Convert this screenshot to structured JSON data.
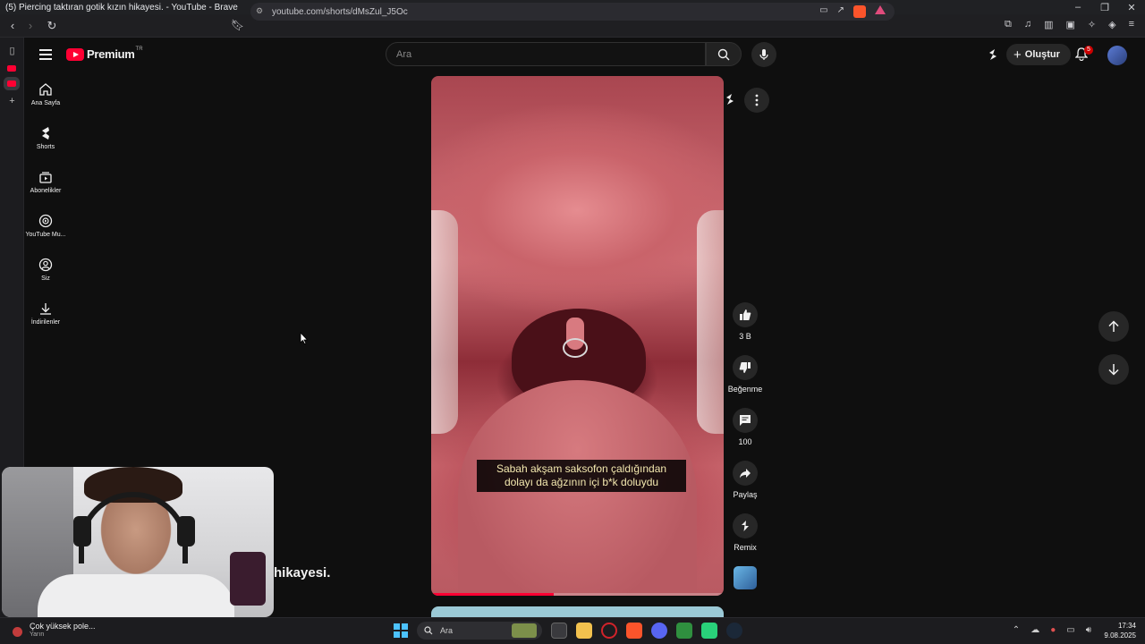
{
  "browser": {
    "window_title": "(5) Piercing taktıran gotik kızın hikayesi. - YouTube - Brave",
    "url": "youtube.com/shorts/dMsZul_J5Oc"
  },
  "youtube": {
    "logo_text": "Premium",
    "logo_region": "TR",
    "search_placeholder": "Ara",
    "create_label": "Oluştur",
    "notification_count": "5"
  },
  "sidebar": {
    "items": [
      {
        "label": "Ana Sayfa",
        "icon": "home-icon"
      },
      {
        "label": "Shorts",
        "icon": "shorts-icon"
      },
      {
        "label": "Abonelikler",
        "icon": "subscriptions-icon"
      },
      {
        "label": "YouTube Mu...",
        "icon": "youtube-music-icon"
      },
      {
        "label": "Siz",
        "icon": "user-icon"
      },
      {
        "label": "İndirilenler",
        "icon": "download-icon"
      }
    ]
  },
  "short": {
    "subtitle_line1": "Sabah akşam saksofon çaldığından",
    "subtitle_line2": "dolayı da ağzının içi b*k doluydu",
    "title_partial": "hikayesi.",
    "progress_fraction": 0.42
  },
  "actions": {
    "like_count": "3 B",
    "dislike_label": "Beğenme",
    "comment_count": "100",
    "share_label": "Paylaş",
    "remix_label": "Remix"
  },
  "taskbar": {
    "weather_title": "Çok yüksek pole...",
    "weather_sub": "Yarın",
    "search_label": "Ara",
    "time": "17:34",
    "date": "9.08.2025"
  },
  "colors": {
    "accent": "#ff0033",
    "background": "#0f0f0f"
  }
}
